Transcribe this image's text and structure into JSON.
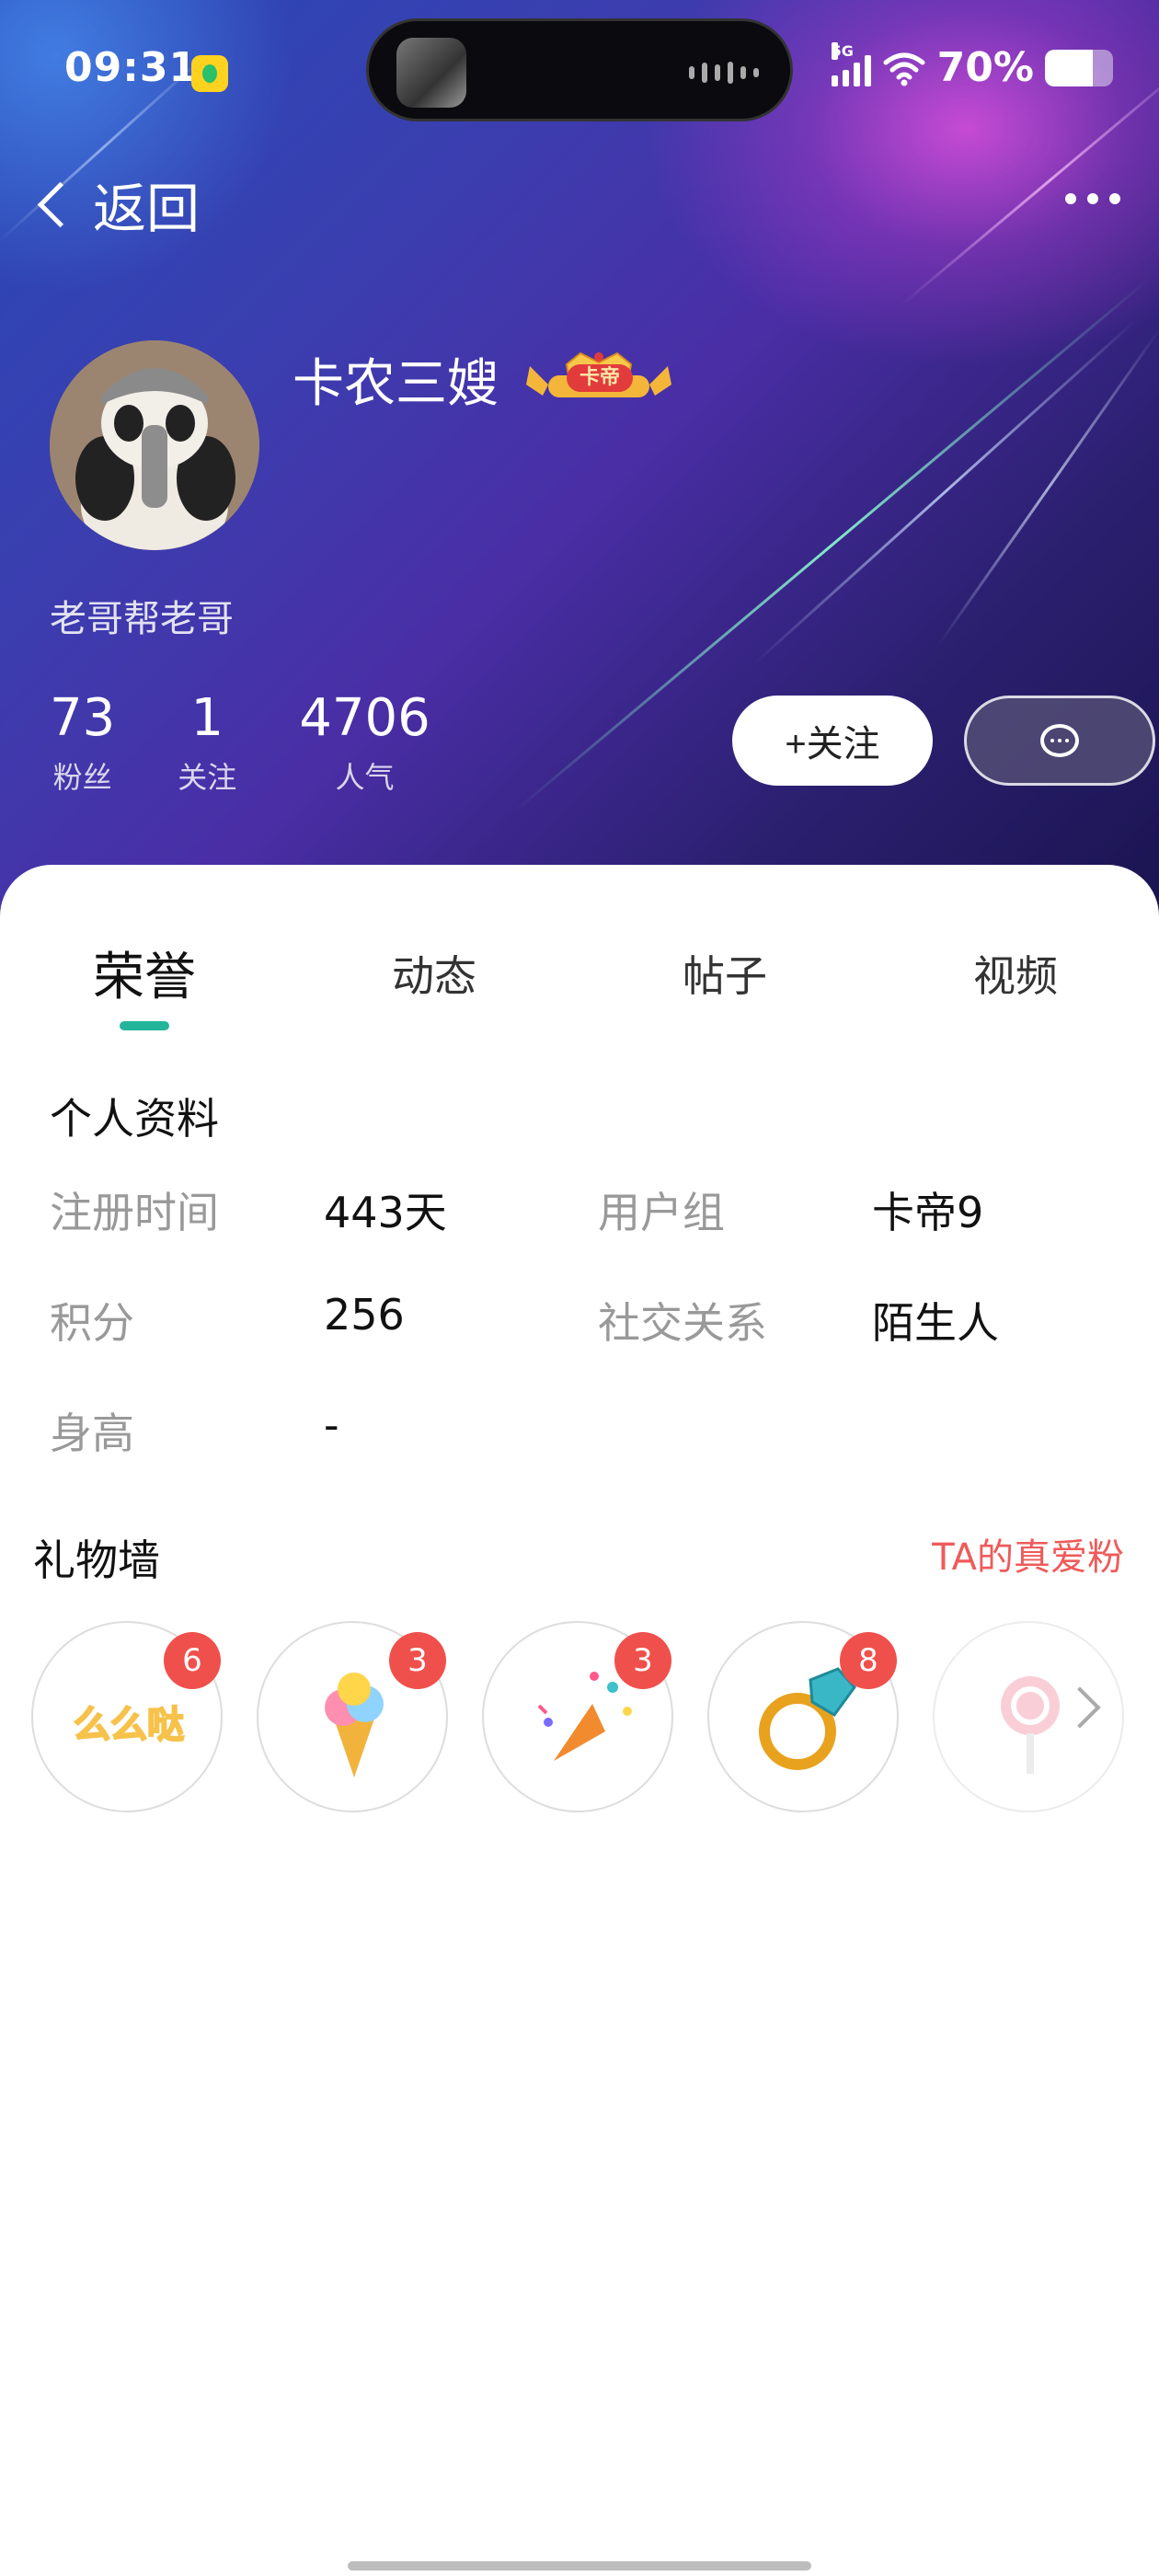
{
  "status_bar": {
    "time": "09:31",
    "network": "5G",
    "battery_percent": "70%",
    "battery_level": 0.7
  },
  "nav": {
    "back_label": "返回"
  },
  "profile": {
    "name": "卡农三嫂",
    "badge": "卡帝",
    "signature": "老哥帮老哥",
    "stats": [
      {
        "value": "73",
        "label": "粉丝"
      },
      {
        "value": "1",
        "label": "关注"
      },
      {
        "value": "4706",
        "label": "人气"
      }
    ],
    "follow_label": "+关注"
  },
  "tabs": [
    "荣誉",
    "动态",
    "帖子",
    "视频"
  ],
  "active_tab": 0,
  "profile_info": {
    "title": "个人资料",
    "rows": [
      {
        "label": "注册时间",
        "value": "443天"
      },
      {
        "label": "用户组",
        "value": "卡帝9"
      },
      {
        "label": "积分",
        "value": "256"
      },
      {
        "label": "社交关系",
        "value": "陌生人"
      },
      {
        "label": "身高",
        "value": "-"
      }
    ]
  },
  "gift_wall": {
    "title": "礼物墙",
    "fans_link": "TA的真爱粉",
    "gifts": [
      {
        "name": "么么哒",
        "count": "6"
      },
      {
        "name": "ice-cream",
        "count": "3"
      },
      {
        "name": "party-popper",
        "count": "3"
      },
      {
        "name": "diamond-ring",
        "count": "8"
      },
      {
        "name": "lollipop",
        "count": ""
      }
    ]
  },
  "colors": {
    "accent_tab": "#23b59a",
    "badge_red": "#f0504c",
    "link_red": "#f05a5a"
  }
}
